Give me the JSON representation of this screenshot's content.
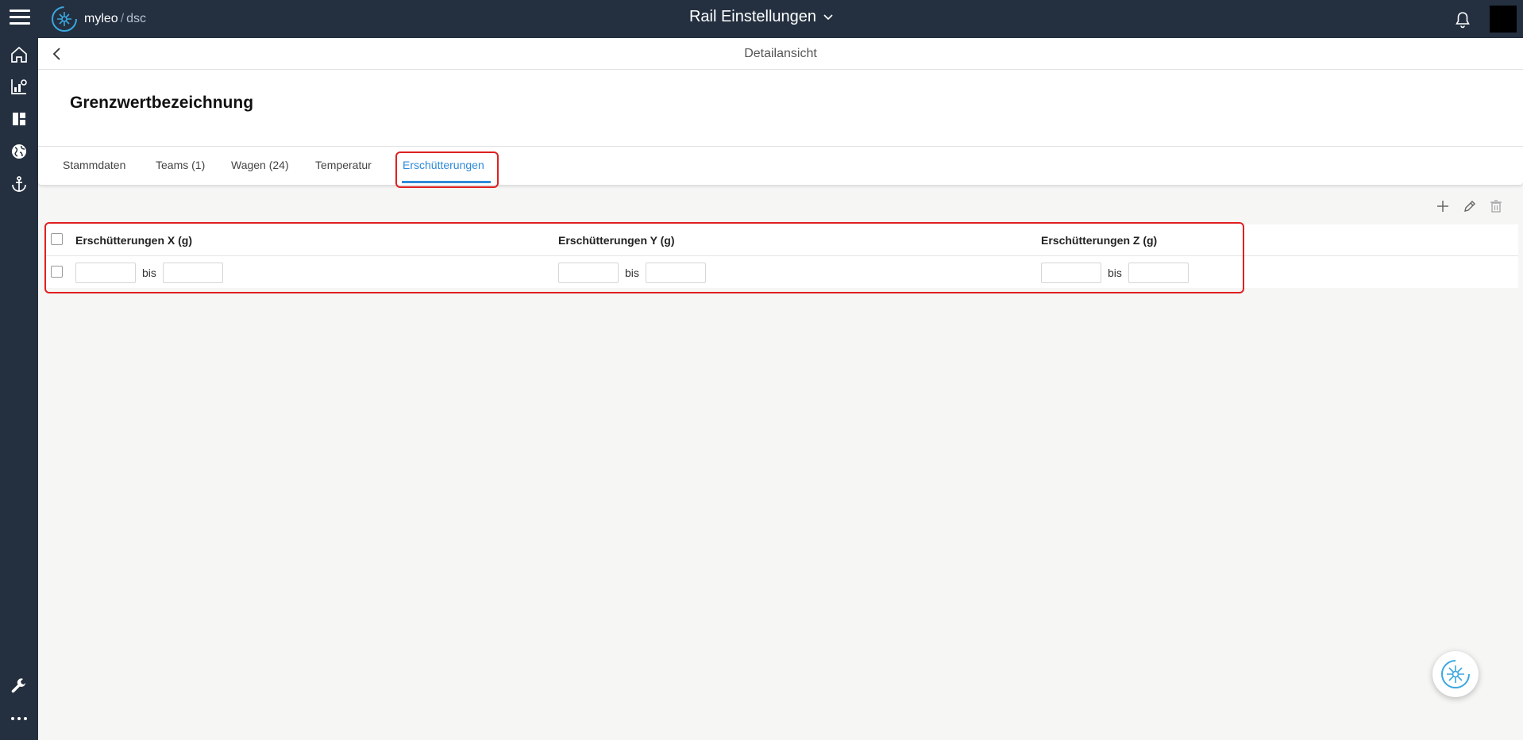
{
  "header": {
    "brand": "myleo",
    "brand_separator": "/",
    "brand_sub": "dsc",
    "app_title": "Rail Einstellungen"
  },
  "sidebar": {
    "items": [
      {
        "icon": "home-icon"
      },
      {
        "icon": "chart-settings-icon"
      },
      {
        "icon": "dashboard-icon"
      },
      {
        "icon": "globe-icon"
      },
      {
        "icon": "anchor-icon"
      },
      {
        "icon": "wrench-icon"
      },
      {
        "icon": "more-icon"
      }
    ]
  },
  "subheader": {
    "title": "Detailansicht"
  },
  "page": {
    "title": "Grenzwertbezeichnung"
  },
  "tabs": [
    {
      "label": "Stammdaten"
    },
    {
      "label": "Teams (1)"
    },
    {
      "label": "Wagen (24)"
    },
    {
      "label": "Temperatur"
    },
    {
      "label": "Erschütterungen",
      "active": true
    }
  ],
  "table": {
    "columns": [
      {
        "label": "Erschütterungen X (g)"
      },
      {
        "label": "Erschütterungen Y (g)"
      },
      {
        "label": "Erschütterungen Z (g)"
      }
    ],
    "row": {
      "separator": "bis",
      "x_from": "",
      "x_to": "",
      "y_from": "",
      "y_to": "",
      "z_from": "",
      "z_to": ""
    }
  },
  "colors": {
    "topbar": "#243040",
    "accent": "#2f8ad8",
    "highlight": "#e02020"
  }
}
